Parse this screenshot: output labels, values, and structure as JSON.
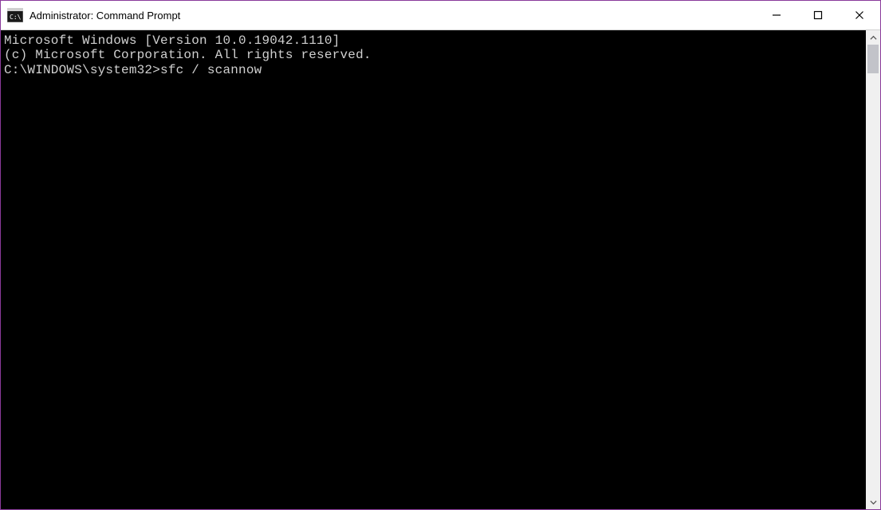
{
  "window": {
    "title": "Administrator: Command Prompt"
  },
  "icons": {
    "app": "cmd-icon",
    "minimize": "minimize-icon",
    "maximize": "maximize-icon",
    "close": "close-icon",
    "scroll_up": "chevron-up-icon",
    "scroll_down": "chevron-down-icon"
  },
  "terminal": {
    "line1": "Microsoft Windows [Version 10.0.19042.1110]",
    "line2": "(c) Microsoft Corporation. All rights reserved.",
    "blank": "",
    "prompt": "C:\\WINDOWS\\system32>",
    "command": "sfc / scannow"
  },
  "colors": {
    "border": "#8a3a9b",
    "terminal_bg": "#000000",
    "terminal_fg": "#d0d0d0",
    "titlebar_bg": "#ffffff"
  }
}
